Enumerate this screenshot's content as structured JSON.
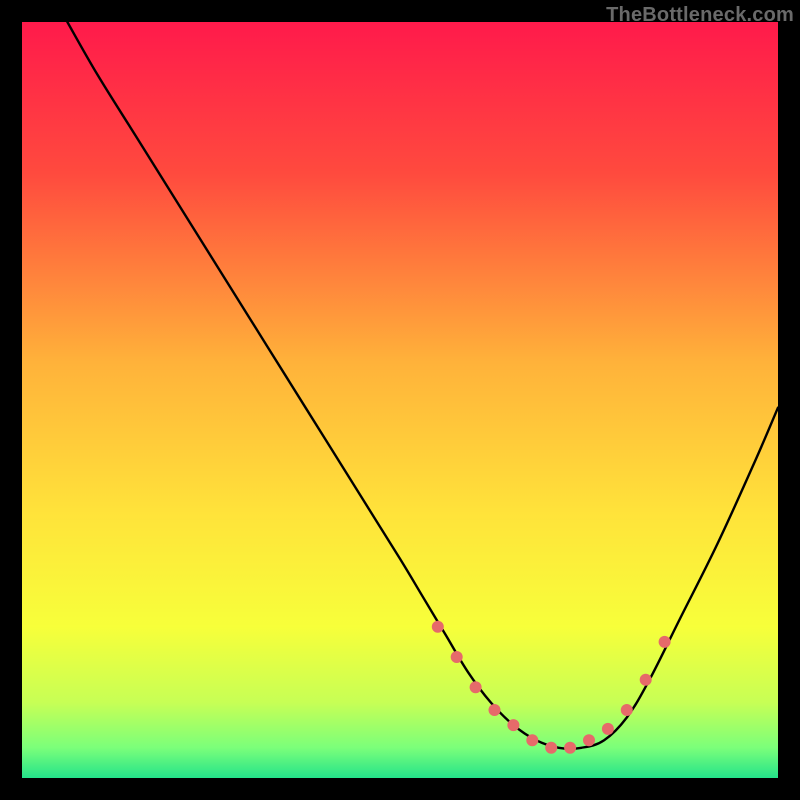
{
  "watermark": "TheBottleneck.com",
  "chart_data": {
    "type": "line",
    "title": "",
    "xlabel": "",
    "ylabel": "",
    "xlim": [
      0,
      100
    ],
    "ylim": [
      0,
      100
    ],
    "grid": false,
    "legend": false,
    "gradient_stops": [
      {
        "offset": 0.0,
        "color": "#ff1a4b"
      },
      {
        "offset": 0.2,
        "color": "#ff4a3e"
      },
      {
        "offset": 0.45,
        "color": "#ffb23a"
      },
      {
        "offset": 0.65,
        "color": "#ffe33a"
      },
      {
        "offset": 0.8,
        "color": "#f7ff3a"
      },
      {
        "offset": 0.9,
        "color": "#c7ff55"
      },
      {
        "offset": 0.96,
        "color": "#7bff7a"
      },
      {
        "offset": 1.0,
        "color": "#24e38a"
      }
    ],
    "series": [
      {
        "name": "bottleneck-curve",
        "color": "#000000",
        "x": [
          6,
          10,
          15,
          20,
          25,
          30,
          35,
          40,
          45,
          50,
          53,
          56,
          59,
          62,
          65,
          68,
          71,
          74,
          77,
          80,
          83,
          87,
          92,
          97,
          100
        ],
        "y": [
          100,
          93,
          85,
          77,
          69,
          61,
          53,
          45,
          37,
          29,
          24,
          19,
          14,
          10,
          7,
          5,
          4,
          4,
          5,
          8,
          13,
          21,
          31,
          42,
          49
        ]
      }
    ],
    "markers": {
      "name": "highlight-points",
      "color": "#e66a6a",
      "radius": 6,
      "x": [
        55,
        57.5,
        60,
        62.5,
        65,
        67.5,
        70,
        72.5,
        75,
        77.5,
        80,
        82.5,
        85
      ],
      "y": [
        20,
        16,
        12,
        9,
        7,
        5,
        4,
        4,
        5,
        6.5,
        9,
        13,
        18
      ]
    }
  }
}
